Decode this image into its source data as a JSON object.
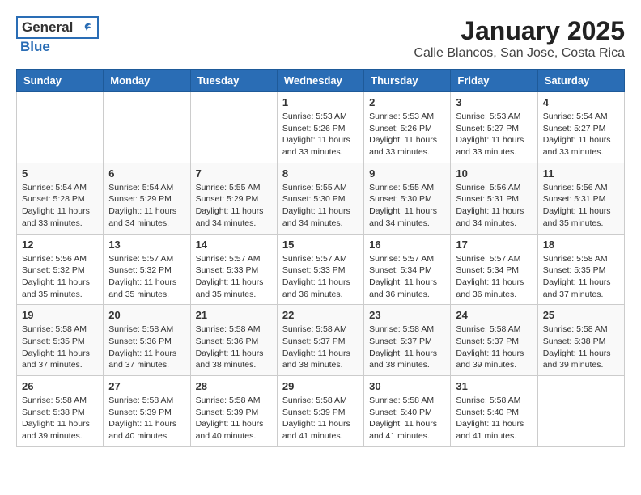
{
  "header": {
    "logo_general": "General",
    "logo_blue": "Blue",
    "month": "January 2025",
    "location": "Calle Blancos, San Jose, Costa Rica"
  },
  "weekdays": [
    "Sunday",
    "Monday",
    "Tuesday",
    "Wednesday",
    "Thursday",
    "Friday",
    "Saturday"
  ],
  "weeks": [
    [
      {
        "day": "",
        "info": ""
      },
      {
        "day": "",
        "info": ""
      },
      {
        "day": "",
        "info": ""
      },
      {
        "day": "1",
        "info": "Sunrise: 5:53 AM\nSunset: 5:26 PM\nDaylight: 11 hours\nand 33 minutes."
      },
      {
        "day": "2",
        "info": "Sunrise: 5:53 AM\nSunset: 5:26 PM\nDaylight: 11 hours\nand 33 minutes."
      },
      {
        "day": "3",
        "info": "Sunrise: 5:53 AM\nSunset: 5:27 PM\nDaylight: 11 hours\nand 33 minutes."
      },
      {
        "day": "4",
        "info": "Sunrise: 5:54 AM\nSunset: 5:27 PM\nDaylight: 11 hours\nand 33 minutes."
      }
    ],
    [
      {
        "day": "5",
        "info": "Sunrise: 5:54 AM\nSunset: 5:28 PM\nDaylight: 11 hours\nand 33 minutes."
      },
      {
        "day": "6",
        "info": "Sunrise: 5:54 AM\nSunset: 5:29 PM\nDaylight: 11 hours\nand 34 minutes."
      },
      {
        "day": "7",
        "info": "Sunrise: 5:55 AM\nSunset: 5:29 PM\nDaylight: 11 hours\nand 34 minutes."
      },
      {
        "day": "8",
        "info": "Sunrise: 5:55 AM\nSunset: 5:30 PM\nDaylight: 11 hours\nand 34 minutes."
      },
      {
        "day": "9",
        "info": "Sunrise: 5:55 AM\nSunset: 5:30 PM\nDaylight: 11 hours\nand 34 minutes."
      },
      {
        "day": "10",
        "info": "Sunrise: 5:56 AM\nSunset: 5:31 PM\nDaylight: 11 hours\nand 34 minutes."
      },
      {
        "day": "11",
        "info": "Sunrise: 5:56 AM\nSunset: 5:31 PM\nDaylight: 11 hours\nand 35 minutes."
      }
    ],
    [
      {
        "day": "12",
        "info": "Sunrise: 5:56 AM\nSunset: 5:32 PM\nDaylight: 11 hours\nand 35 minutes."
      },
      {
        "day": "13",
        "info": "Sunrise: 5:57 AM\nSunset: 5:32 PM\nDaylight: 11 hours\nand 35 minutes."
      },
      {
        "day": "14",
        "info": "Sunrise: 5:57 AM\nSunset: 5:33 PM\nDaylight: 11 hours\nand 35 minutes."
      },
      {
        "day": "15",
        "info": "Sunrise: 5:57 AM\nSunset: 5:33 PM\nDaylight: 11 hours\nand 36 minutes."
      },
      {
        "day": "16",
        "info": "Sunrise: 5:57 AM\nSunset: 5:34 PM\nDaylight: 11 hours\nand 36 minutes."
      },
      {
        "day": "17",
        "info": "Sunrise: 5:57 AM\nSunset: 5:34 PM\nDaylight: 11 hours\nand 36 minutes."
      },
      {
        "day": "18",
        "info": "Sunrise: 5:58 AM\nSunset: 5:35 PM\nDaylight: 11 hours\nand 37 minutes."
      }
    ],
    [
      {
        "day": "19",
        "info": "Sunrise: 5:58 AM\nSunset: 5:35 PM\nDaylight: 11 hours\nand 37 minutes."
      },
      {
        "day": "20",
        "info": "Sunrise: 5:58 AM\nSunset: 5:36 PM\nDaylight: 11 hours\nand 37 minutes."
      },
      {
        "day": "21",
        "info": "Sunrise: 5:58 AM\nSunset: 5:36 PM\nDaylight: 11 hours\nand 38 minutes."
      },
      {
        "day": "22",
        "info": "Sunrise: 5:58 AM\nSunset: 5:37 PM\nDaylight: 11 hours\nand 38 minutes."
      },
      {
        "day": "23",
        "info": "Sunrise: 5:58 AM\nSunset: 5:37 PM\nDaylight: 11 hours\nand 38 minutes."
      },
      {
        "day": "24",
        "info": "Sunrise: 5:58 AM\nSunset: 5:37 PM\nDaylight: 11 hours\nand 39 minutes."
      },
      {
        "day": "25",
        "info": "Sunrise: 5:58 AM\nSunset: 5:38 PM\nDaylight: 11 hours\nand 39 minutes."
      }
    ],
    [
      {
        "day": "26",
        "info": "Sunrise: 5:58 AM\nSunset: 5:38 PM\nDaylight: 11 hours\nand 39 minutes."
      },
      {
        "day": "27",
        "info": "Sunrise: 5:58 AM\nSunset: 5:39 PM\nDaylight: 11 hours\nand 40 minutes."
      },
      {
        "day": "28",
        "info": "Sunrise: 5:58 AM\nSunset: 5:39 PM\nDaylight: 11 hours\nand 40 minutes."
      },
      {
        "day": "29",
        "info": "Sunrise: 5:58 AM\nSunset: 5:39 PM\nDaylight: 11 hours\nand 41 minutes."
      },
      {
        "day": "30",
        "info": "Sunrise: 5:58 AM\nSunset: 5:40 PM\nDaylight: 11 hours\nand 41 minutes."
      },
      {
        "day": "31",
        "info": "Sunrise: 5:58 AM\nSunset: 5:40 PM\nDaylight: 11 hours\nand 41 minutes."
      },
      {
        "day": "",
        "info": ""
      }
    ]
  ]
}
